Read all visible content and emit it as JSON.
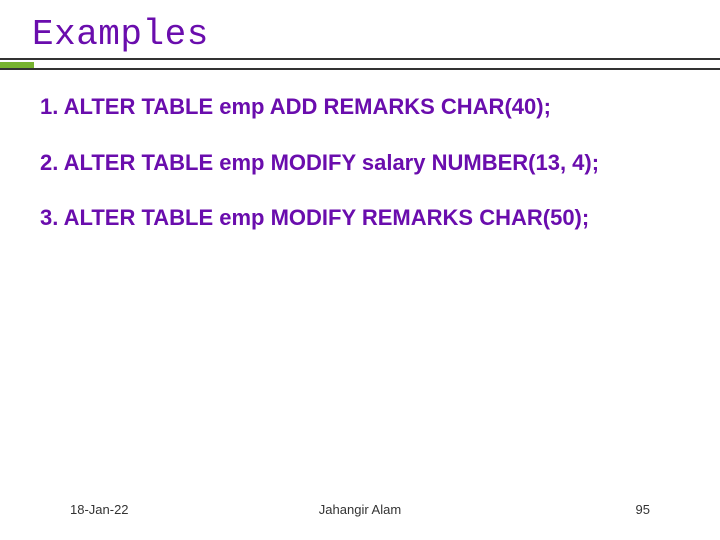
{
  "title": "Examples",
  "items": [
    "1. ALTER TABLE emp ADD REMARKS CHAR(40);",
    "2. ALTER TABLE emp MODIFY salary NUMBER(13, 4);",
    "3. ALTER TABLE emp MODIFY REMARKS CHAR(50);"
  ],
  "footer": {
    "date": "18-Jan-22",
    "author": "Jahangir Alam",
    "page": "95"
  },
  "colors": {
    "accent_purple": "#6a0dad",
    "accent_green": "#77b32f"
  }
}
